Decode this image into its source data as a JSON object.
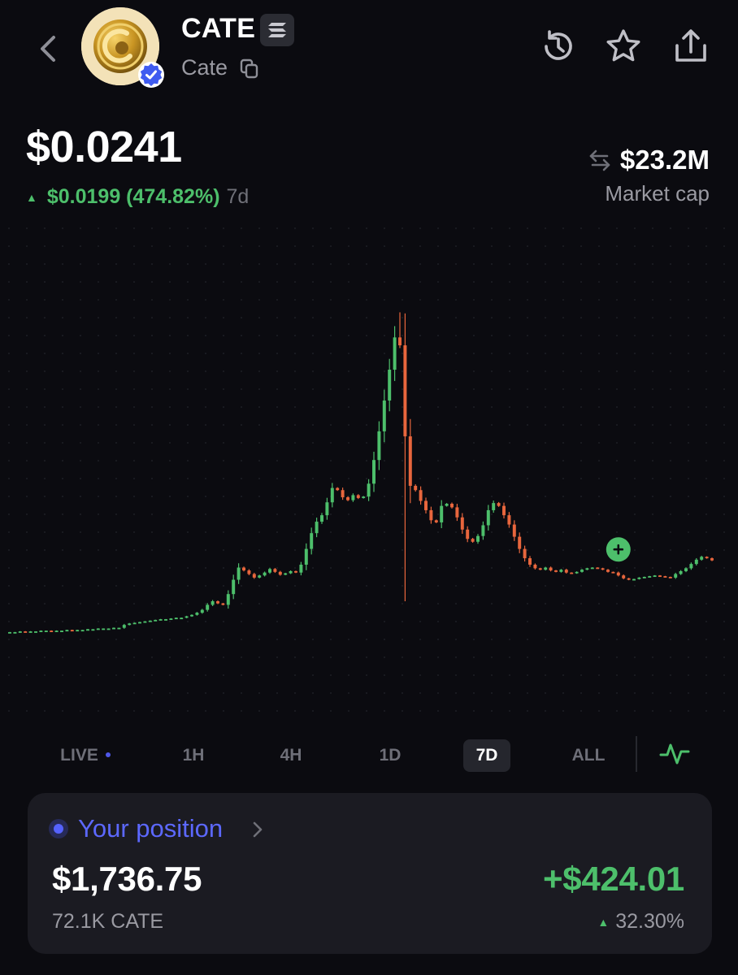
{
  "header": {
    "symbol": "CATE",
    "name": "Cate",
    "icons": [
      "back-chevron-icon",
      "token-logo",
      "verified-badge-icon",
      "chain-badge-icon",
      "copy-icon",
      "history-icon",
      "star-icon",
      "share-icon"
    ]
  },
  "price": {
    "value": "$0.0241",
    "change": "$0.0199 (474.82%)",
    "period": "7d",
    "direction": "up"
  },
  "market_cap": {
    "value": "$23.2M",
    "label": "Market cap"
  },
  "timeframes": {
    "items": [
      "LIVE",
      "1H",
      "4H",
      "1D",
      "7D",
      "ALL"
    ],
    "selected": "7D",
    "chart_type_icon": "line-chart-icon"
  },
  "position": {
    "title": "Your position",
    "value": "$1,736.75",
    "amount": "72.1K CATE",
    "pnl": "+$424.01",
    "pnl_percent": "32.30%"
  },
  "colors": {
    "up": "#4dbf6b",
    "down": "#e8663d",
    "accent": "#5c68ff",
    "background": "#0b0b10",
    "card": "#1b1b22"
  },
  "chart_data": {
    "type": "candlestick",
    "title": "",
    "xlabel": "",
    "ylabel": "",
    "ylim": [
      0.0,
      0.051
    ],
    "grid": "dotted",
    "marker": "buy-marker",
    "closes": [
      0.0042,
      0.0042,
      0.0043,
      0.0042,
      0.0043,
      0.0043,
      0.0044,
      0.0044,
      0.0043,
      0.0044,
      0.0044,
      0.0045,
      0.0044,
      0.0045,
      0.0045,
      0.0046,
      0.0046,
      0.0047,
      0.0047,
      0.0047,
      0.0048,
      0.0048,
      0.0052,
      0.0054,
      0.0055,
      0.0056,
      0.0057,
      0.0058,
      0.0059,
      0.006,
      0.006,
      0.0061,
      0.0062,
      0.0062,
      0.0064,
      0.0066,
      0.0069,
      0.0073,
      0.008,
      0.0085,
      0.0082,
      0.008,
      0.0095,
      0.0115,
      0.0132,
      0.0128,
      0.0123,
      0.0118,
      0.0121,
      0.0125,
      0.013,
      0.0126,
      0.0122,
      0.0124,
      0.0127,
      0.0125,
      0.0136,
      0.0158,
      0.018,
      0.0196,
      0.0205,
      0.0223,
      0.0243,
      0.024,
      0.023,
      0.0226,
      0.0233,
      0.0229,
      0.0231,
      0.0249,
      0.0282,
      0.0322,
      0.0365,
      0.0408,
      0.0453,
      0.0442,
      0.0315,
      0.0246,
      0.024,
      0.0225,
      0.0212,
      0.0198,
      0.0195,
      0.0218,
      0.0221,
      0.0216,
      0.0202,
      0.0185,
      0.0172,
      0.0168,
      0.0176,
      0.0191,
      0.0212,
      0.0222,
      0.0218,
      0.0205,
      0.0192,
      0.0175,
      0.0158,
      0.0145,
      0.0136,
      0.0131,
      0.0129,
      0.0132,
      0.0128,
      0.0126,
      0.0129,
      0.0125,
      0.0124,
      0.0126,
      0.0129,
      0.0131,
      0.0132,
      0.0131,
      0.0129,
      0.0126,
      0.0125,
      0.0121,
      0.0117,
      0.0115,
      0.0116,
      0.0118,
      0.0119,
      0.012,
      0.0121,
      0.012,
      0.0119,
      0.0118,
      0.0123,
      0.0127,
      0.0131,
      0.0137,
      0.0143,
      0.0147,
      0.0145,
      0.0142
    ]
  }
}
